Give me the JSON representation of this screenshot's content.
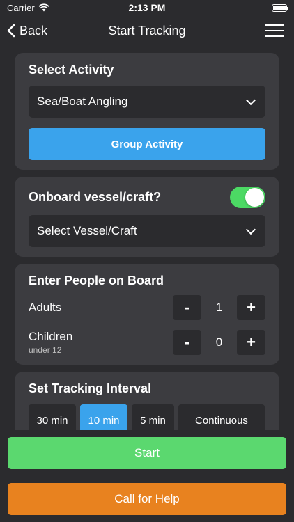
{
  "status_bar": {
    "carrier": "Carrier",
    "time": "2:13 PM"
  },
  "nav": {
    "back_label": "Back",
    "title": "Start Tracking",
    "menu_icon": "hamburger-menu-icon"
  },
  "activity": {
    "heading": "Select Activity",
    "selected": "Sea/Boat Angling",
    "group_button": "Group Activity"
  },
  "vessel": {
    "heading": "Onboard vessel/craft?",
    "toggle_on": true,
    "select_placeholder": "Select Vessel/Craft"
  },
  "people": {
    "heading": "Enter People on Board",
    "adults_label": "Adults",
    "adults_value": "1",
    "children_label": "Children",
    "children_sublabel": "under 12",
    "children_value": "0",
    "minus_label": "-",
    "plus_label": "+"
  },
  "interval": {
    "heading": "Set Tracking Interval",
    "options": [
      "30 min",
      "10 min",
      "5 min",
      "Continuous"
    ],
    "selected": "10 min"
  },
  "actions": {
    "start_label": "Start",
    "help_label": "Call for Help"
  },
  "colors": {
    "accent_blue": "#3aa3ec",
    "start_green": "#5bd86f",
    "help_orange": "#e8821f",
    "toggle_green": "#4cd964"
  }
}
